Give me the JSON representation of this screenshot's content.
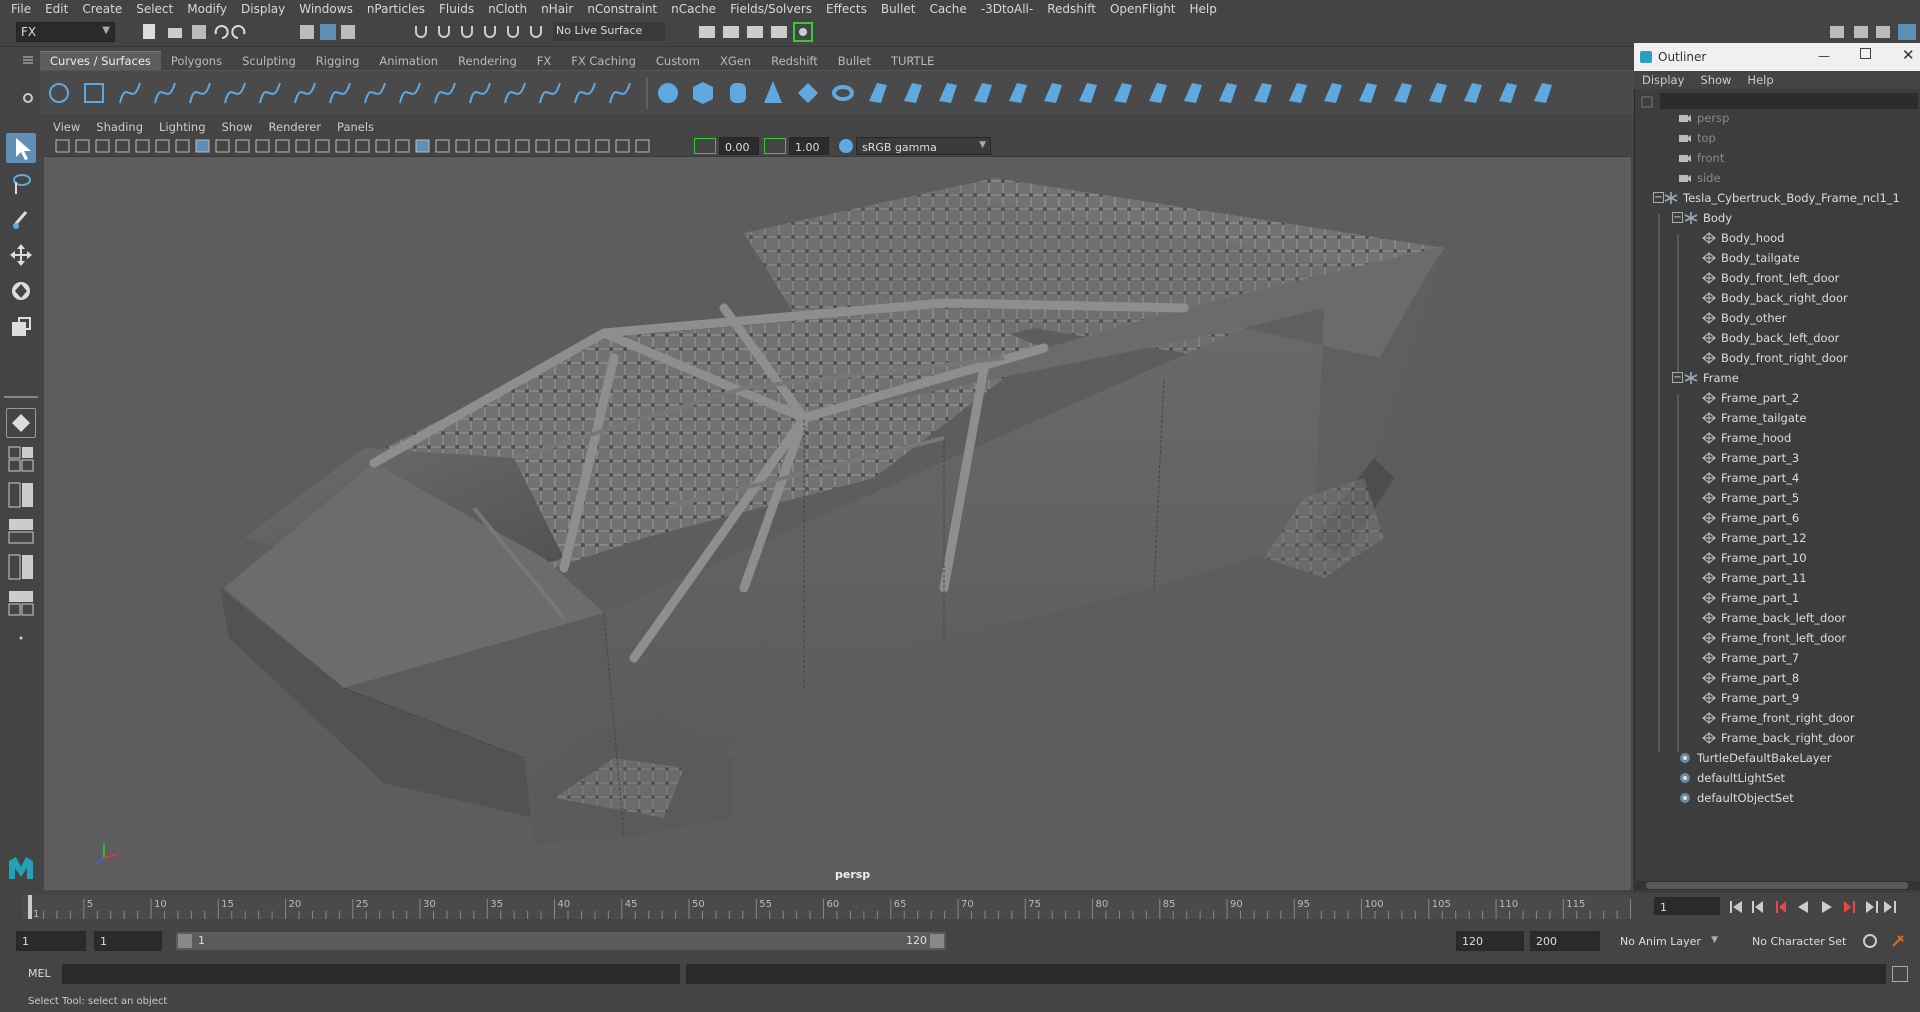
{
  "menubar": [
    "File",
    "Edit",
    "Create",
    "Select",
    "Modify",
    "Display",
    "Windows",
    "nParticles",
    "Fluids",
    "nCloth",
    "nHair",
    "nConstraint",
    "nCache",
    "Fields/Solvers",
    "Effects",
    "Bullet",
    "Cache",
    "-3DtoAll-",
    "Redshift",
    "OpenFlight",
    "Help"
  ],
  "status": {
    "mode": "FX",
    "live_surface": "No Live Surface"
  },
  "shelf_tabs": [
    "Curves / Surfaces",
    "Polygons",
    "Sculpting",
    "Rigging",
    "Animation",
    "Rendering",
    "FX",
    "FX Caching",
    "Custom",
    "XGen",
    "Redshift",
    "Bullet",
    "TURTLE"
  ],
  "shelf_active": "Curves / Surfaces",
  "panel_menu": [
    "View",
    "Shading",
    "Lighting",
    "Show",
    "Renderer",
    "Panels"
  ],
  "panel_toolbar": {
    "exposure": "0.00",
    "gamma": "1.00",
    "color_space": "sRGB gamma"
  },
  "viewport": {
    "camera": "persp"
  },
  "outliner": {
    "title": "Outliner",
    "menu": [
      "Display",
      "Show",
      "Help"
    ],
    "cameras": [
      "persp",
      "top",
      "front",
      "side"
    ],
    "root": "Tesla_Cybertruck_Body_Frame_ncl1_1",
    "body_group": "Body",
    "body_items": [
      "Body_hood",
      "Body_tailgate",
      "Body_front_left_door",
      "Body_back_right_door",
      "Body_other",
      "Body_back_left_door",
      "Body_front_right_door"
    ],
    "frame_group": "Frame",
    "frame_items": [
      "Frame_part_2",
      "Frame_tailgate",
      "Frame_hood",
      "Frame_part_3",
      "Frame_part_4",
      "Frame_part_5",
      "Frame_part_6",
      "Frame_part_12",
      "Frame_part_10",
      "Frame_part_11",
      "Frame_part_1",
      "Frame_back_left_door",
      "Frame_front_left_door",
      "Frame_part_7",
      "Frame_part_8",
      "Frame_part_9",
      "Frame_front_right_door",
      "Frame_back_right_door"
    ],
    "sets": [
      "TurtleDefaultBakeLayer",
      "defaultLightSet",
      "defaultObjectSet"
    ]
  },
  "timeline": {
    "ticks": [
      "1",
      "5",
      "10",
      "15",
      "20",
      "25",
      "30",
      "35",
      "40",
      "45",
      "50",
      "55",
      "60",
      "65",
      "70",
      "75",
      "80",
      "85",
      "90",
      "95",
      "100",
      "105",
      "110",
      "115"
    ],
    "current_frame": "1"
  },
  "range": {
    "start": "1",
    "anim_start": "1",
    "range_start": "1",
    "range_end": "120",
    "end": "120",
    "anim_end": "200",
    "anim_layer": "No Anim Layer",
    "char_set": "No Character Set"
  },
  "cmd": {
    "lang": "MEL"
  },
  "help": "Select Tool: select an object"
}
